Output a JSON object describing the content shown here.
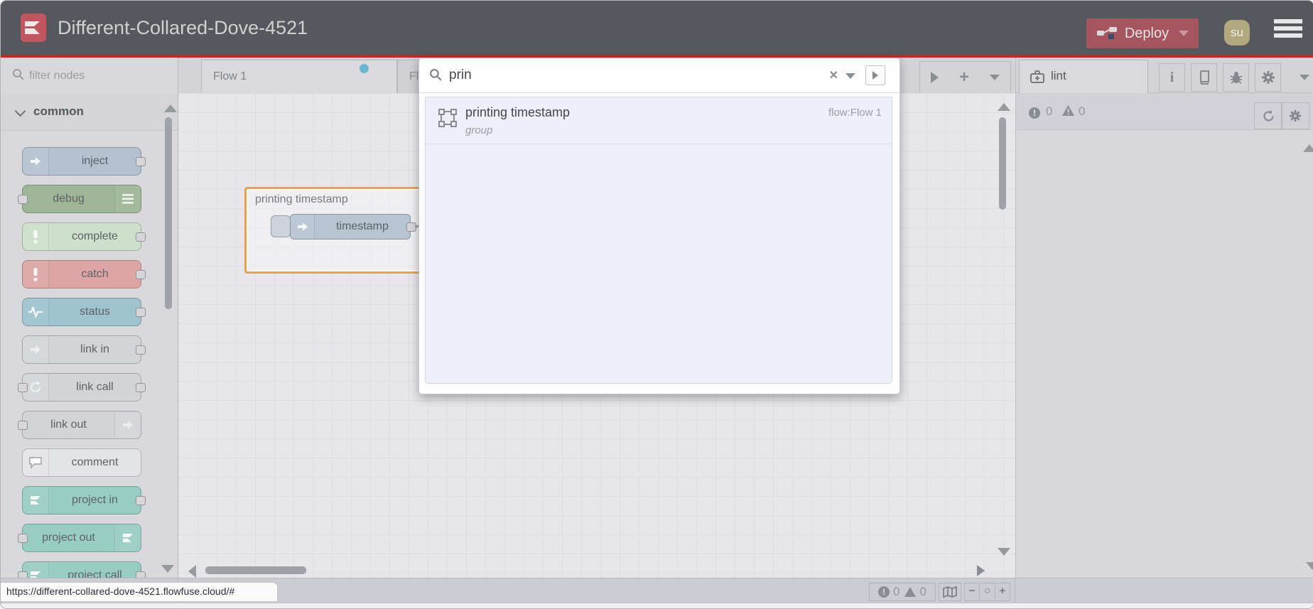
{
  "header": {
    "title": "Different-Collared-Dove-4521",
    "deploy_label": "Deploy",
    "avatar_initials": "su",
    "icons": [
      "flowfuse-logo",
      "deploy-nodes-icon",
      "hamburger-menu-icon",
      "deploy-caret-icon"
    ],
    "colors": {
      "header_bg": "#55585c",
      "accent_line": "#d6201f",
      "deploy_red": "#a4555e",
      "avatar_olive": "#b2a87d",
      "logo_red": "#c2565e"
    }
  },
  "palette": {
    "filter_placeholder": "filter nodes",
    "filter_icon": "search-icon",
    "category": "common",
    "nodes": [
      {
        "label": "inject",
        "color": "#b4c1d1",
        "icon": "inject-arrow-icon",
        "icon_side": "left",
        "ports": "right"
      },
      {
        "label": "debug",
        "color": "#9db695",
        "icon": "debug-list-icon",
        "icon_side": "right",
        "ports": "left"
      },
      {
        "label": "complete",
        "color": "#cde0cb",
        "icon": "exclamation-icon",
        "icon_side": "left",
        "ports": "right"
      },
      {
        "label": "catch",
        "color": "#dda5a3",
        "icon": "exclamation-icon",
        "icon_side": "left",
        "ports": "right"
      },
      {
        "label": "status",
        "color": "#9fc3cf",
        "icon": "pulse-icon",
        "icon_side": "left",
        "ports": "right"
      },
      {
        "label": "link in",
        "color": "#d2d4d7",
        "icon": "link-in-icon",
        "icon_side": "left",
        "ports": "right"
      },
      {
        "label": "link call",
        "color": "#d2d4d7",
        "icon": "link-call-icon",
        "icon_side": "left",
        "ports": "both"
      },
      {
        "label": "link out",
        "color": "#d2d4d7",
        "icon": "link-out-icon",
        "icon_side": "right",
        "ports": "left"
      },
      {
        "label": "comment",
        "color": "#e3e4e7",
        "icon": "comment-icon",
        "icon_side": "left",
        "ports": "none"
      },
      {
        "label": "project in",
        "color": "#98cdc3",
        "icon": "flowfuse-icon",
        "icon_side": "left",
        "ports": "right"
      },
      {
        "label": "project out",
        "color": "#98cdc3",
        "icon": "flowfuse-icon",
        "icon_side": "right",
        "ports": "left"
      },
      {
        "label": "project call",
        "color": "#98cdc3",
        "icon": "flowfuse-icon",
        "icon_side": "left",
        "ports": "both"
      }
    ]
  },
  "tabs": {
    "active_label": "Flow 1",
    "second_label": "Fl",
    "unsaved_dot_color": "#6cb5d2",
    "toolbar_icons": [
      "scroll-tabs-right-icon",
      "add-flow-icon",
      "flow-list-caret-icon"
    ]
  },
  "search": {
    "query": "prin",
    "icons": [
      "search-icon",
      "clear-icon",
      "history-caret-icon",
      "expand-results-icon"
    ],
    "results": [
      {
        "title": "printing timestamp",
        "type": "group",
        "flow": "flow:Flow 1",
        "icon": "group-icon"
      }
    ]
  },
  "canvas": {
    "group_label": "printing timestamp",
    "node_label": "timestamp",
    "group_border_color": "#e0a35c",
    "node_color": "#b7c4d2"
  },
  "sidebar": {
    "tab_label": "lint",
    "tab_icon": "medkit-icon",
    "toolbar_icons": [
      "info-icon",
      "book-icon",
      "bug-icon",
      "gear-icon",
      "caret-down-icon"
    ],
    "error_count": "0",
    "warning_count": "0",
    "lint_toolbar_icons": [
      "refresh-icon",
      "gear-icon"
    ]
  },
  "footer": {
    "error_count": "0",
    "warning_count": "0",
    "icons": [
      "error-circle-icon",
      "warning-triangle-icon",
      "map-icon",
      "zoom-out-icon",
      "zoom-reset-icon",
      "zoom-in-icon"
    ]
  },
  "statusbar": {
    "url": "https://different-collared-dove-4521.flowfuse.cloud/#"
  }
}
